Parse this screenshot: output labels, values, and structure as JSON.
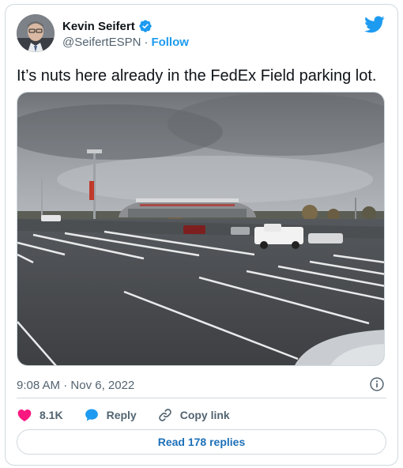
{
  "author": {
    "display_name": "Kevin Seifert",
    "handle": "@SeifertESPN",
    "separator": "·",
    "follow_label": "Follow"
  },
  "tweet": {
    "text": "It’s nuts here already in the FedEx Field parking lot.",
    "time": "9:08 AM",
    "date_separator": "·",
    "date": "Nov 6, 2022"
  },
  "actions": {
    "likes": "8.1K",
    "reply_label": "Reply",
    "copy_link_label": "Copy link"
  },
  "read_replies_label": "Read 178 replies",
  "icons": {
    "verified": "verified-badge-icon",
    "brand": "twitter-bird-icon",
    "info": "info-icon",
    "like": "heart-icon",
    "reply": "speech-bubble-icon",
    "copy_link": "link-icon"
  },
  "colors": {
    "brand_blue": "#1d9bf0",
    "like_pink": "#f91880",
    "text_secondary": "#536471",
    "border": "#cfd9de"
  }
}
